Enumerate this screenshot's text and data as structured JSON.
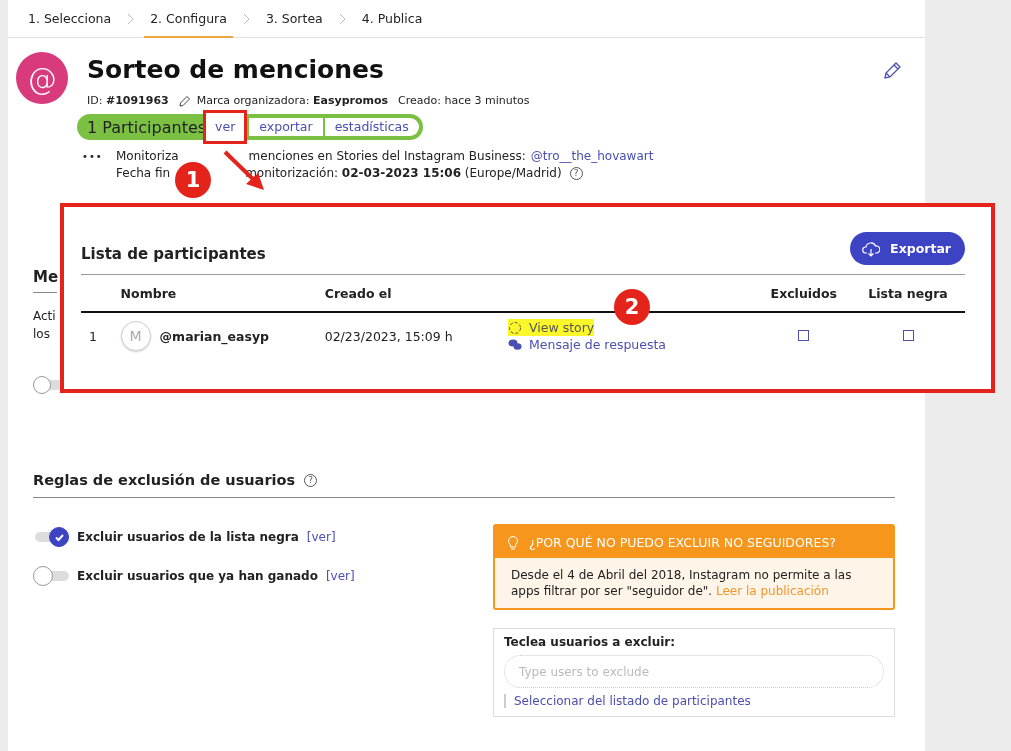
{
  "steps": [
    {
      "label": "1. Selecciona",
      "selected": false
    },
    {
      "label": "2. Configura",
      "selected": true
    },
    {
      "label": "3. Sortea",
      "selected": false
    },
    {
      "label": "4. Publica",
      "selected": false
    }
  ],
  "header": {
    "avatar_symbol": "@",
    "title": "Sorteo de menciones",
    "id_text": "ID: **#1091963**",
    "brand_text": "Marca organizadora: **Easypromos**",
    "created": "Creado: hace 3 minutos"
  },
  "participants_bar": {
    "count": "1 Participantes",
    "actions": [
      {
        "label": "ver",
        "highlighted": true
      },
      {
        "label": "exportar",
        "highlighted": false
      },
      {
        "label": "estadísticas",
        "highlighted": false
      }
    ]
  },
  "monitoring": {
    "more": "•••",
    "line1_start": "Monitoriza",
    "line1_end": "menciones en Stories del Instagram Business:",
    "account": "@tro__the_hovawart",
    "line2_start": "Fecha fin",
    "line2_end": "monitorización: **02-03-2023 15:06** (Europe/Madrid)",
    "help_icon": "?"
  },
  "annotations": [
    {
      "number": "1"
    },
    {
      "number": "2"
    }
  ],
  "background_section": {
    "title": "Me",
    "lines": [
      "Acti",
      "los"
    ],
    "toggle_on": false
  },
  "modal": {
    "title": "Lista de participantes",
    "export_button": "Exportar",
    "columns": [
      "Nombre",
      "Creado el",
      "Excluidos",
      "Lista negra"
    ],
    "rows": [
      {
        "index": "1",
        "avatar_initial": "M",
        "name": "@marian_easyp",
        "created": "02/23/2023, 15:09 h",
        "links": [
          {
            "kind": "story",
            "label": "View story",
            "highlighted": true
          },
          {
            "kind": "message",
            "label": "Mensaje de respuesta",
            "highlighted": false
          }
        ],
        "excluded": false,
        "blacklisted": false
      }
    ]
  },
  "exclusion": {
    "title": "Reglas de exclusión de usuarios",
    "help_icon": "?",
    "rules": [
      {
        "label": "Excluir usuarios de la lista negra",
        "link": "[ver]",
        "on": true
      },
      {
        "label": "Excluir usuarios que ya han ganado",
        "link": "[ver]",
        "on": false
      }
    ],
    "notice": {
      "title": "¿POR QUÉ NO PUEDO EXCLUIR NO SEGUIDORES?",
      "text": "Desde el 4 de Abril del 2018, Instagram no permite a las apps filtrar por ser \"seguidor de\".",
      "link": "Leer la publicación"
    },
    "exclude_box": {
      "label": "Teclea usuarios a excluir:",
      "placeholder": "Type users to exclude",
      "link": "Seleccionar del listado de participantes"
    }
  }
}
